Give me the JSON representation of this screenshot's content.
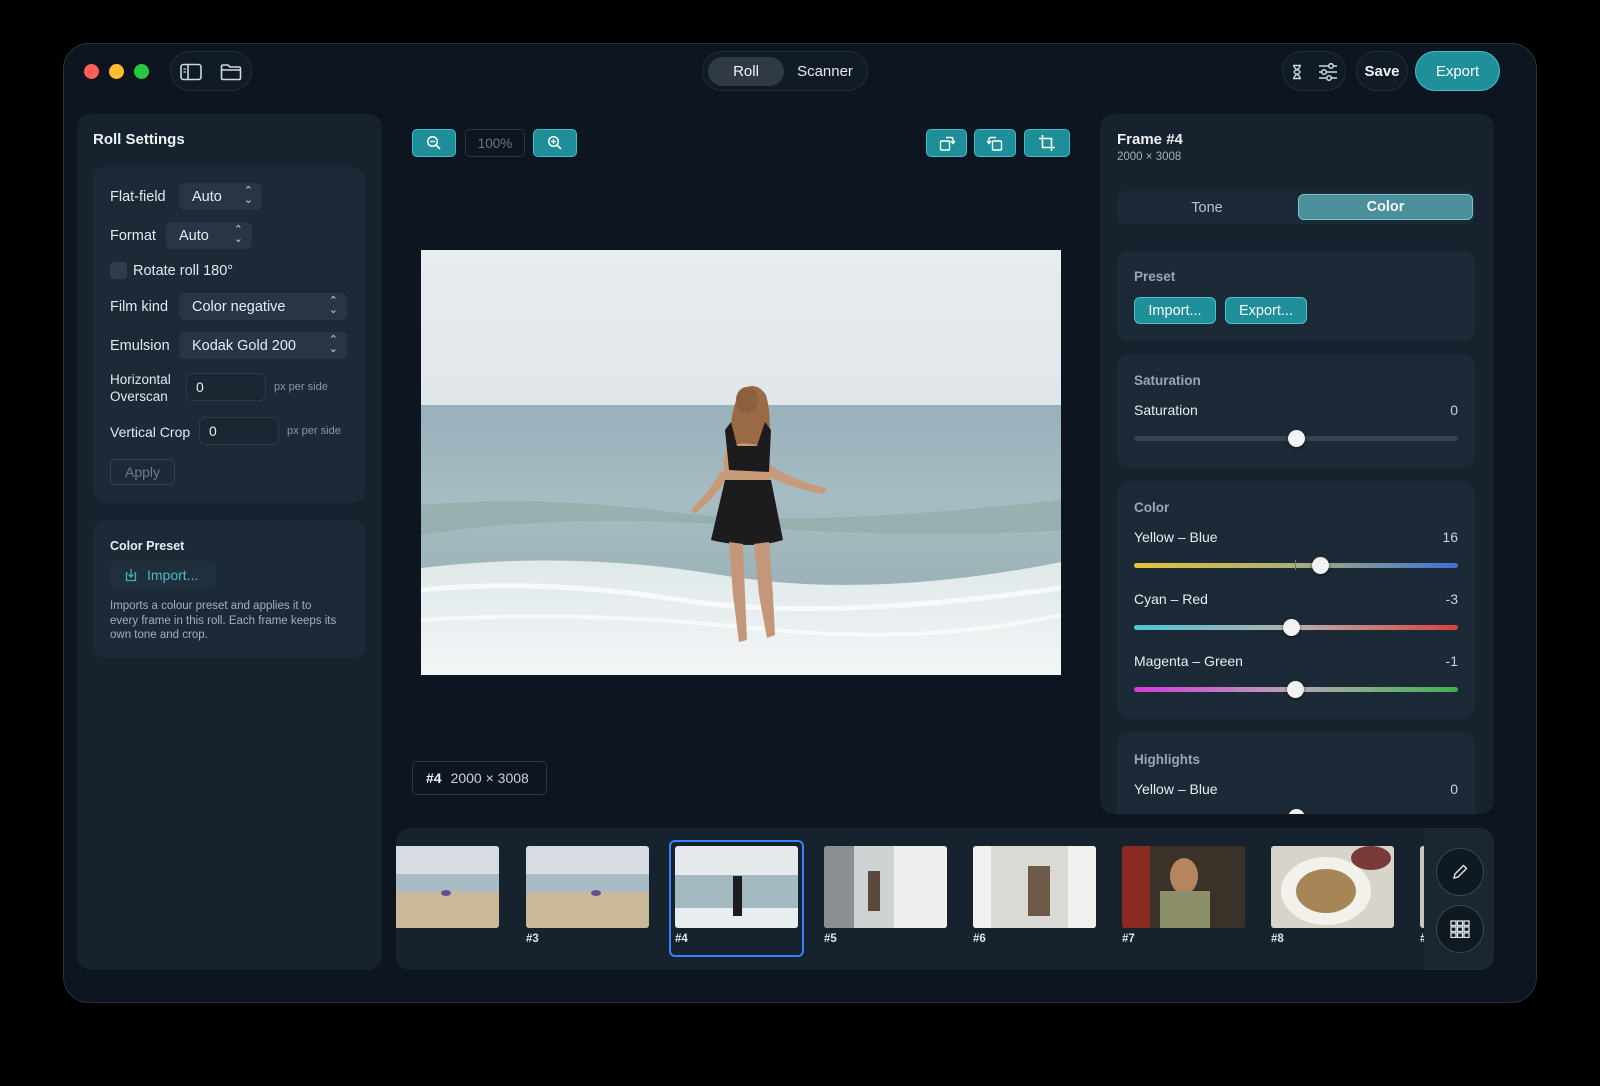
{
  "titlebar": {
    "segments": [
      "Roll",
      "Scanner"
    ],
    "active_segment": "Roll",
    "save_label": "Save",
    "export_label": "Export"
  },
  "roll_settings": {
    "title": "Roll Settings",
    "flatfield_label": "Flat-field",
    "flatfield_value": "Auto",
    "format_label": "Format",
    "format_value": "Auto",
    "rotate_label": "Rotate roll 180°",
    "filmkind_label": "Film kind",
    "filmkind_value": "Color negative",
    "emulsion_label": "Emulsion",
    "emulsion_value": "Kodak Gold 200",
    "h_overscan_label1": "Horizontal",
    "h_overscan_label2": "Overscan",
    "h_overscan_value": "0",
    "v_crop_label": "Vertical Crop",
    "v_crop_value": "0",
    "unit": "px per side",
    "apply_label": "Apply"
  },
  "color_preset": {
    "title": "Color Preset",
    "import_label": "Import...",
    "description1": "Imports a colour preset and applies it to",
    "description2": "every frame in this roll. Each frame keeps its",
    "description3": "own tone and crop."
  },
  "viewer": {
    "zoom": "100%",
    "frame_tag": "#4",
    "frame_dims": "2000 × 3008"
  },
  "frame_panel": {
    "title": "Frame #4",
    "dims": "2000 × 3008",
    "tabs": [
      "Tone",
      "Color"
    ],
    "active_tab": "Color",
    "preset_title": "Preset",
    "import_label": "Import...",
    "export_label": "Export...",
    "saturation_title": "Saturation",
    "saturation_label": "Saturation",
    "saturation_value": "0",
    "color_title": "Color",
    "yb_label": "Yellow – Blue",
    "yb_value": "16",
    "cr_label": "Cyan – Red",
    "cr_value": "-3",
    "mg_label": "Magenta – Green",
    "mg_value": "-1",
    "highlights_title": "Highlights",
    "hl_yb_label": "Yellow – Blue",
    "hl_yb_value": "0"
  },
  "sliders": {
    "saturation": 0.5,
    "yellow_blue": 0.575,
    "cyan_red": 0.487,
    "magenta_green": 0.497,
    "highlights_yellow_blue": 0.5
  },
  "filmstrip": {
    "frames": [
      "#3",
      "#4",
      "#5",
      "#6",
      "#7",
      "#8",
      "#"
    ],
    "selected": "#4"
  },
  "colors": {
    "accent": "#1f8f9a",
    "window_bg": "#0d1620",
    "panel_bg": "#16222e",
    "card_bg": "#1c2a37",
    "selection": "#3b82f6"
  },
  "icons": [
    "sidebar-icon",
    "folder-icon",
    "hourglass-icon",
    "sliders-icon",
    "zoom-out-icon",
    "zoom-in-icon",
    "rotate-right-icon",
    "rotate-left-icon",
    "crop-icon",
    "import-icon",
    "pencil-icon",
    "grid-icon"
  ]
}
